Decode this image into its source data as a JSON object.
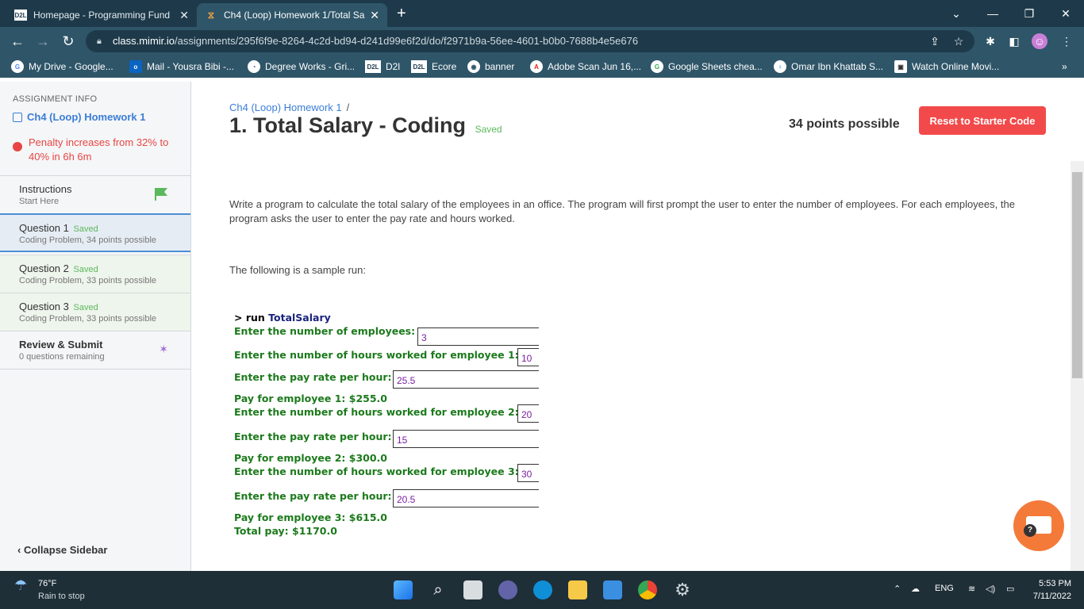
{
  "browser": {
    "tabs": [
      {
        "label": "Homepage - Programming Fund",
        "active": false
      },
      {
        "label": "Ch4 (Loop) Homework 1/Total Sa",
        "active": true
      }
    ],
    "url_host": "class.mimir.io",
    "url_path": "/assignments/295f6f9e-8264-4c2d-bd94-d241d99e6f2d/do/f2971b9a-56ee-4601-b0b0-7688b4e5e676",
    "bookmarks": [
      "My Drive - Google...",
      "Mail - Yousra Bibi -...",
      "Degree Works - Gri...",
      "D2l",
      "Ecore",
      "banner",
      "Adobe Scan Jun 16,...",
      "Google Sheets chea...",
      "Omar Ibn Khattab S...",
      "Watch Online Movi..."
    ]
  },
  "sidebar": {
    "section_label": "ASSIGNMENT INFO",
    "homework": "Ch4 (Loop) Homework 1",
    "penalty": "Penalty increases from 32% to 40% in 6h 6m",
    "items": [
      {
        "title": "Instructions",
        "saved": "",
        "sub": "Start Here"
      },
      {
        "title": "Question 1",
        "saved": "Saved",
        "sub": "Coding Problem, 34 points possible"
      },
      {
        "title": "Question 2",
        "saved": "Saved",
        "sub": "Coding Problem, 33 points possible"
      },
      {
        "title": "Question 3",
        "saved": "Saved",
        "sub": "Coding Problem, 33 points possible"
      },
      {
        "title": "Review & Submit",
        "saved": "",
        "sub": "0 questions remaining"
      }
    ],
    "collapse": "Collapse Sidebar"
  },
  "main": {
    "breadcrumb": "Ch4 (Loop) Homework 1",
    "title": "1. Total Salary - Coding",
    "saved": "Saved",
    "points": "34 points possible",
    "reset": "Reset to Starter Code",
    "description": "Write a program to calculate the total salary of the employees in an office. The program will first prompt the user to enter the number of employees. For each employees, the program asks the user to enter the pay rate and hours worked.",
    "sample_intro": "The following is a sample run:",
    "run": {
      "cmd_prefix": "> run ",
      "cmd_name": "TotalSalary",
      "p_emp": "Enter the number of employees:",
      "v_emp": "3",
      "p_h1": "Enter the number of hours worked for employee 1:",
      "v_h1": "10",
      "p_r1": "Enter the pay rate per hour:",
      "v_r1": "25.5",
      "pay1": "Pay for employee 1: $255.0",
      "p_h2": "Enter the number of hours worked for employee 2:",
      "v_h2": "20",
      "p_r2": "Enter the pay rate per hour:",
      "v_r2": "15",
      "pay2": "Pay for employee 2: $300.0",
      "p_h3": "Enter the number of hours worked for employee 3:",
      "v_h3": "30",
      "p_r3": "Enter the pay rate per hour:",
      "v_r3": "20.5",
      "pay3": "Pay for employee 3: $615.0",
      "total": "Total pay: $1170.0"
    }
  },
  "taskbar": {
    "temp": "76°F",
    "weather": "Rain to stop",
    "lang": "ENG",
    "time": "5:53 PM",
    "date": "7/11/2022"
  }
}
